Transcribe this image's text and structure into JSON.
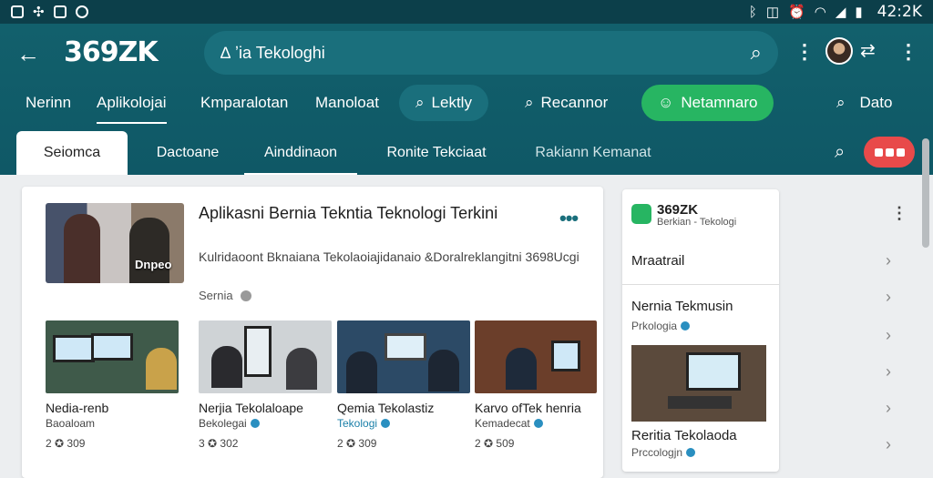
{
  "status": {
    "time": "42:2K"
  },
  "appbar": {
    "logo": "369ZK",
    "search_query": "∆ ʼia Tekologhi"
  },
  "nav1": {
    "items": [
      "Nerinn",
      "Aplikolojai",
      "Kmparalotan",
      "Manoloat"
    ],
    "pill_dark": "Lektly",
    "pill_plain": "Recannor",
    "pill_green": "Netamnaro",
    "right_label": "Dato"
  },
  "nav2": {
    "items": [
      "Seiomca",
      "Dactoane",
      "Ainddinaon",
      "Ronite Tekciaat",
      "Rakiann Kemanat"
    ]
  },
  "main_card": {
    "hero_caption": "Dnpeo",
    "title": "Aplikasni Bernia Tekntia Teknologi Terkini",
    "desc": "Kulridaoont Bknaiana Tekolaoiajidanaio &Doralreklangitni 3698Ucgi",
    "meta": "Sernia",
    "tiles": [
      {
        "title": "Nedia-renb",
        "cat": "Baoaloam",
        "views": "2 ✪ 309"
      },
      {
        "title": "Nerjia Tekolaloape",
        "cat": "Bekolegai",
        "views": "3 ✪ 302"
      },
      {
        "title": "Qemia Tekolastiz",
        "cat": "Tekologi",
        "views": "2 ✪ 309"
      },
      {
        "title": "Karvo ofTek henria",
        "cat": "Kemadecat",
        "views": "2 ✪ 509"
      }
    ]
  },
  "side_card": {
    "name": "369ZK",
    "sub": "Berkian - Tekologi",
    "section": "Mraatrail",
    "item1_title": "Nernia Tekmusin",
    "item1_cat": "Prkologia",
    "item2_title": "Reritia Tekolaoda",
    "item2_cat": "Prccologjn"
  },
  "colors": {
    "teal": "#0f5866",
    "green": "#27b562",
    "red": "#e84a4a"
  }
}
